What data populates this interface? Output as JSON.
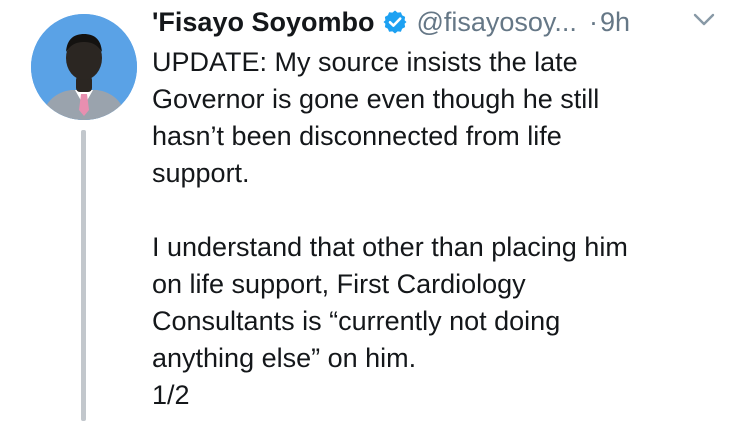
{
  "tweet": {
    "author": {
      "display_name": "'Fisayo Soyombo",
      "handle": "@fisayosoy...",
      "verified": true
    },
    "separator": "·",
    "timestamp": "9h",
    "body": {
      "paragraph1": [
        "UPDATE: My source insists the late",
        "Governor is gone even though he still",
        "hasn’t been disconnected from life",
        "support."
      ],
      "paragraph2": [
        "I understand that other than placing him",
        "on life support, First Cardiology",
        "Consultants is “currently not doing",
        "anything else” on him.",
        "1/2"
      ]
    }
  },
  "icons": {
    "verified": "verified-badge-icon",
    "menu": "chevron-down-icon"
  },
  "colors": {
    "avatar_bg": "#5aa2e6",
    "verified_blue": "#1da1f2",
    "secondary_text": "#657786",
    "thread_line": "#c2c7cc"
  }
}
